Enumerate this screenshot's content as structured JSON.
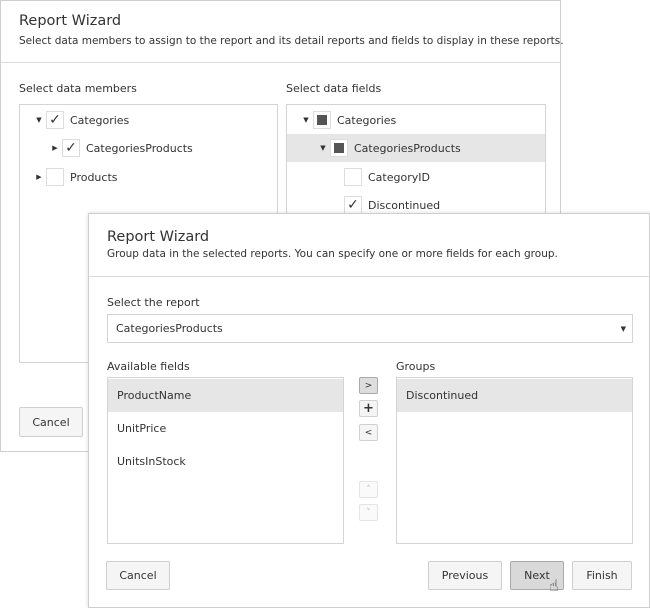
{
  "back": {
    "title": "Report Wizard",
    "subtitle": "Select data members to assign to the report and its detail reports and fields to display in these reports.",
    "members_label": "Select data members",
    "fields_label": "Select data fields",
    "members": [
      {
        "label": "Categories",
        "checked": true,
        "expanded": true
      },
      {
        "label": "CategoriesProducts",
        "checked": true,
        "expanded": false
      },
      {
        "label": "Products",
        "checked": false,
        "expanded": false
      }
    ],
    "fields": [
      {
        "label": "Categories",
        "state": "indeterminate"
      },
      {
        "label": "CategoriesProducts",
        "state": "indeterminate"
      },
      {
        "label": "CategoryID",
        "state": "unchecked"
      },
      {
        "label": "Discontinued",
        "state": "checked"
      }
    ],
    "cancel": "Cancel"
  },
  "front": {
    "title": "Report Wizard",
    "subtitle": "Group data in the selected reports. You can specify one or more fields for each group.",
    "report_label": "Select the report",
    "report_value": "CategoriesProducts",
    "available_label": "Available fields",
    "available": [
      "ProductName",
      "UnitPrice",
      "UnitsInStock"
    ],
    "groups_label": "Groups",
    "groups": [
      "Discontinued"
    ],
    "cancel": "Cancel",
    "previous": "Previous",
    "next": "Next",
    "finish": "Finish"
  }
}
